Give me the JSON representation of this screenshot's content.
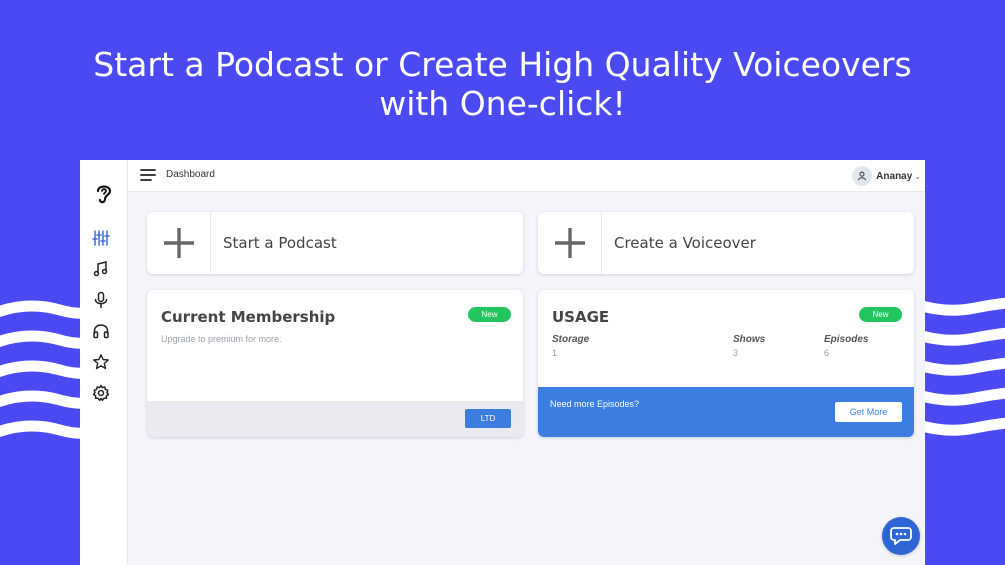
{
  "headline": {
    "line1": "Start a Podcast or Create High Quality Voiceovers",
    "line2": "with One-click!"
  },
  "colors": {
    "background": "#4a49f2",
    "accent_blue": "#3b7ee0",
    "badge_green": "#22c55e",
    "sidebar_icon": "#3b6fd8"
  },
  "sidebar": {
    "logo": "ear-logo-icon",
    "items": [
      {
        "icon": "sliders-icon",
        "active": true
      },
      {
        "icon": "music-note-icon"
      },
      {
        "icon": "microphone-icon"
      },
      {
        "icon": "headphones-icon"
      },
      {
        "icon": "star-icon"
      },
      {
        "icon": "gear-icon"
      }
    ]
  },
  "topbar": {
    "breadcrumb": "Dashboard",
    "user_name": "Ananay"
  },
  "actions": {
    "podcast_label": "Start a Podcast",
    "voiceover_label": "Create a Voiceover"
  },
  "membership": {
    "title": "Current Membership",
    "badge": "New",
    "subtitle": "Upgrade to premium for more.",
    "plan_button": "LTD"
  },
  "usage": {
    "title": "USAGE",
    "badge": "New",
    "stats": [
      {
        "label": "Storage",
        "value": "1"
      },
      {
        "label": "Shows",
        "value": "3"
      },
      {
        "label": "Episodes",
        "value": "6"
      }
    ],
    "cta_text": "Need more Episodes?",
    "cta_button": "Get More"
  }
}
